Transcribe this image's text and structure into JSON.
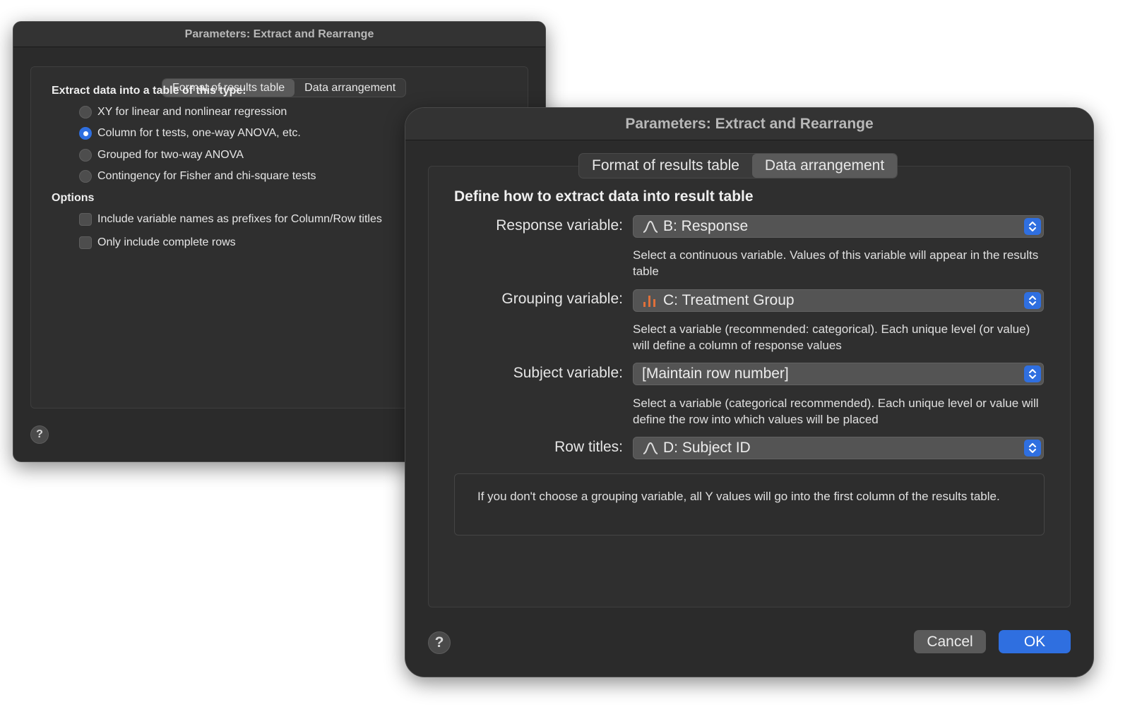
{
  "back_window": {
    "title": "Parameters: Extract and Rearrange",
    "tabs": [
      "Format of results table",
      "Data arrangement"
    ],
    "active_tab": "Format of results table",
    "section_title": "Extract data into a table of this type:",
    "radios": [
      {
        "label": "XY for linear and nonlinear regression",
        "selected": false
      },
      {
        "label": "Column for t tests, one-way ANOVA, etc.",
        "selected": true
      },
      {
        "label": "Grouped for two-way ANOVA",
        "selected": false
      },
      {
        "label": "Contingency for Fisher and chi-square tests",
        "selected": false
      }
    ],
    "options_title": "Options",
    "checkboxes": [
      {
        "label": "Include variable names as prefixes for Column/Row titles",
        "checked": false
      },
      {
        "label": "Only include complete rows",
        "checked": false
      }
    ],
    "help_label": "?"
  },
  "front_window": {
    "title": "Parameters: Extract and Rearrange",
    "tabs": [
      "Format of results table",
      "Data arrangement"
    ],
    "active_tab": "Data arrangement",
    "heading": "Define how to extract  data into result table",
    "fields": [
      {
        "label": "Response variable:",
        "value": "B: Response",
        "icon": "continuous-variable-icon",
        "hint": "Select a continuous variable. Values of this variable will appear in the results table"
      },
      {
        "label": "Grouping variable:",
        "value": "C: Treatment Group",
        "icon": "categorical-variable-icon",
        "hint": "Select a variable (recommended: categorical). Each unique level (or value) will define a column of response values"
      },
      {
        "label": "Subject variable:",
        "value": "[Maintain row number]",
        "icon": "",
        "hint": "Select a variable (categorical recommended). Each unique level or value will define the row into which values will be placed"
      },
      {
        "label": "Row titles:",
        "value": "D: Subject ID",
        "icon": "continuous-variable-icon",
        "hint": ""
      }
    ],
    "note": "If you don't choose a grouping variable, all Y values will go into the first column of the results table.",
    "buttons": {
      "cancel": "Cancel",
      "ok": "OK"
    },
    "help_label": "?",
    "colors": {
      "accent": "#2f6fe0",
      "categorical_icon": "#e0703a"
    }
  }
}
